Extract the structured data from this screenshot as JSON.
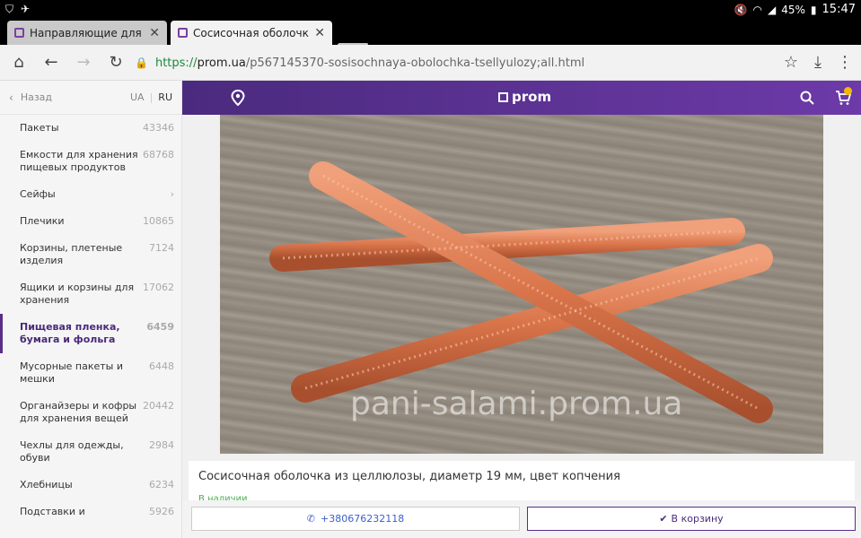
{
  "status_bar": {
    "battery": "45%",
    "time": "15:47",
    "icons": [
      "shield-icon",
      "airplane-icon",
      "mute-icon",
      "wifi-icon",
      "signal-icon",
      "battery-icon"
    ]
  },
  "tabs": [
    {
      "title": "Направляющие для ящико",
      "active": false
    },
    {
      "title": "Сосисочная оболочка из ц",
      "active": true
    }
  ],
  "omnibox": {
    "scheme": "https://",
    "domain": "prom.ua",
    "path": "/p567145370-sosisochnaya-obolochka-tsellyulozy;all.html"
  },
  "sidebar": {
    "back_label": "Назад",
    "lang_ua": "UA",
    "lang_ru": "RU",
    "categories": [
      {
        "label": "Пакеты",
        "count": "43346"
      },
      {
        "label": "Емкости для хранения пищевых продуктов",
        "count": "68768"
      },
      {
        "label": "Сейфы",
        "count": "›"
      },
      {
        "label": "Плечики",
        "count": "10865"
      },
      {
        "label": "Корзины, плетеные изделия",
        "count": "7124"
      },
      {
        "label": "Ящики и корзины для хранения",
        "count": "17062"
      },
      {
        "label": "Пищевая пленка, бумага и фольга",
        "count": "6459"
      },
      {
        "label": "Мусорные пакеты и мешки",
        "count": "6448"
      },
      {
        "label": "Органайзеры и кофры для хранения вещей",
        "count": "20442"
      },
      {
        "label": "Чехлы для одежды, обуви",
        "count": "2984"
      },
      {
        "label": "Хлебницы",
        "count": "6234"
      },
      {
        "label": "Подставки и",
        "count": "5926"
      }
    ]
  },
  "header": {
    "logo": "prom"
  },
  "product": {
    "watermark": "pani-salami.prom.ua",
    "title": "Сосисочная оболочка из целлюлозы, диаметр 19 мм, цвет копчения",
    "stock": "В наличии",
    "phone": "+380676232118",
    "cart_label": "В корзину"
  },
  "colors": {
    "brand_purple": "#5a2d86",
    "stock_green": "#4caf50",
    "phone_blue": "#3a5fcc"
  }
}
